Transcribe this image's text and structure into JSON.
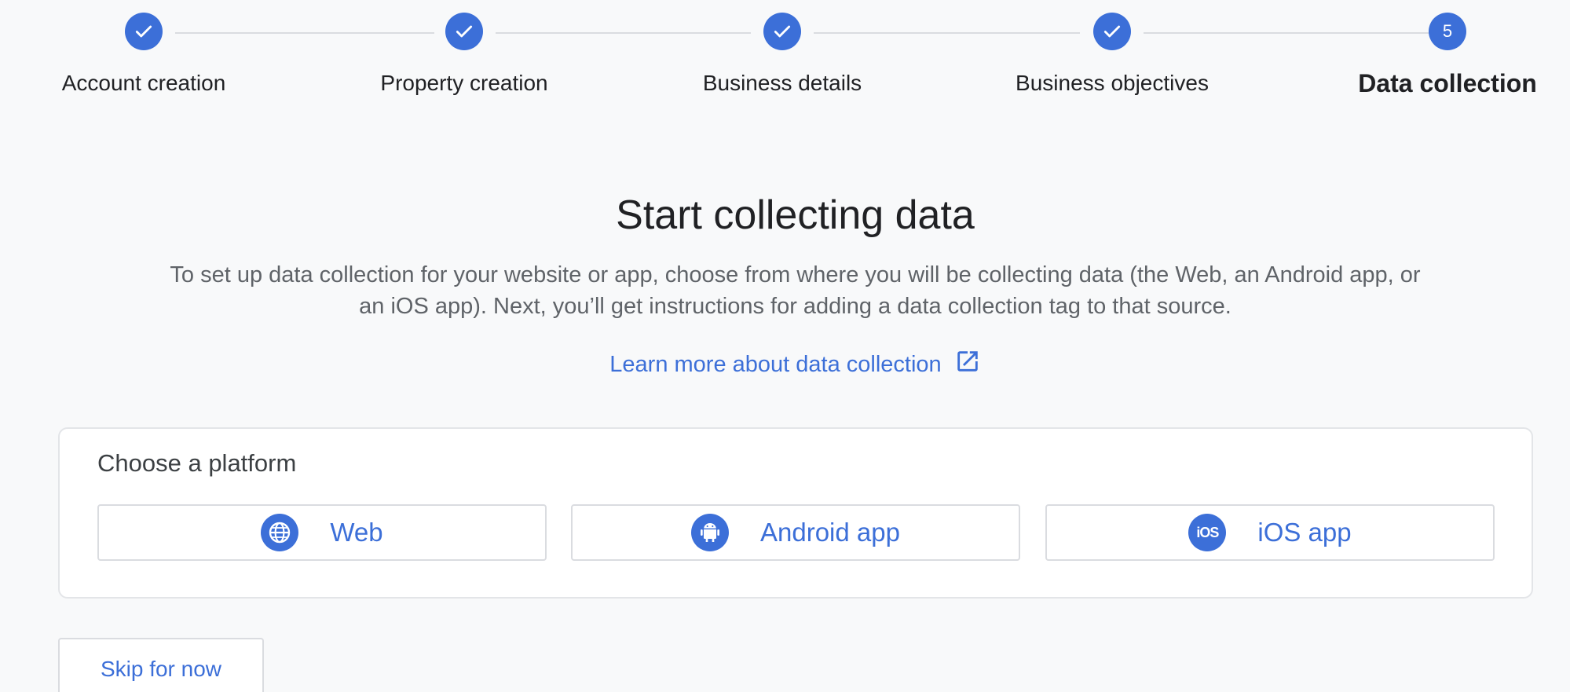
{
  "stepper": {
    "steps": [
      {
        "label": "Account creation",
        "status": "complete",
        "icon": "check-icon"
      },
      {
        "label": "Property creation",
        "status": "complete",
        "icon": "check-icon"
      },
      {
        "label": "Business details",
        "status": "complete",
        "icon": "check-icon"
      },
      {
        "label": "Business objectives",
        "status": "complete",
        "icon": "check-icon"
      },
      {
        "label": "Data collection",
        "status": "current",
        "number": "5"
      }
    ]
  },
  "main": {
    "title": "Start collecting data",
    "description": "To set up data collection for your website or app, choose from where you will be collecting data (the Web, an Android app, or an iOS app). Next, you’ll get instructions for adding a data collection tag to that source.",
    "learn_more": "Learn more about data collection",
    "learn_more_icon": "open-in-new-icon"
  },
  "platform_card": {
    "title": "Choose a platform",
    "options": [
      {
        "label": "Web",
        "icon": "globe-icon"
      },
      {
        "label": "Android app",
        "icon": "android-icon"
      },
      {
        "label": "iOS app",
        "icon": "ios-icon",
        "glyph": "iOS"
      }
    ]
  },
  "footer": {
    "skip_label": "Skip for now"
  },
  "colors": {
    "accent": "#3c6fd8",
    "background": "#f8f9fa",
    "border": "#dadce0"
  }
}
